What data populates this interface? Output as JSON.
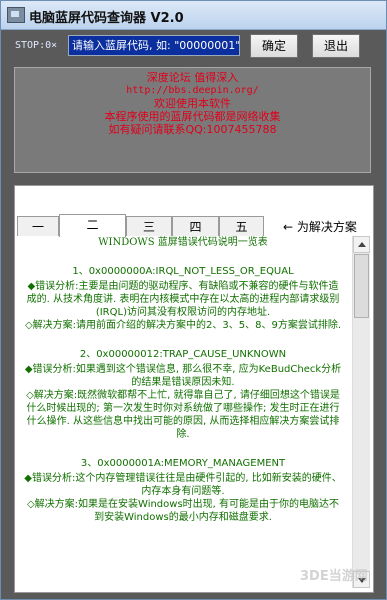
{
  "window": {
    "title": "电脑蓝屏代码查询器 V2.0"
  },
  "toolbar": {
    "status": "STOP:0×",
    "code_input_value": "请输入蓝屏代码, 如: \"00000001\".",
    "confirm_label": "确定",
    "exit_label": "退出"
  },
  "banner": {
    "lines": [
      "深度论坛 值得深入",
      "http://bbs.deepin.org/",
      "欢迎使用本软件",
      "本程序使用的蓝屏代码都是网络收集",
      "如有疑问请联系QQ:1007455788"
    ]
  },
  "tabs": [
    "一",
    "二",
    "三",
    "四",
    "五"
  ],
  "solution_link": "← 为解决方案",
  "content": {
    "heading": "WINDOWS 蓝屏错误代码说明一览表",
    "entries": [
      {
        "code": "1、0x0000000A:IRQL_NOT_LESS_OR_EQUAL",
        "analysis": "◆错误分析:主要是由问题的驱动程序、有缺陷或不兼容的硬件与软件造成的. 从技术角度讲. 表明在内核模式中存在以太高的进程内部请求级别(IRQL)访问其没有权限访问的内存地址.",
        "solution": "◇解决方案:请用前面介绍的解决方案中的2、3、5、8、9方案尝试排除."
      },
      {
        "code": "2、0x00000012:TRAP_CAUSE_UNKNOWN",
        "analysis": "◆错误分析:如果遇到这个错误信息, 那么很不幸, 应为KeBudCheck分析的结果是错误原因未知.",
        "solution": "◇解决方案:既然微软都帮不上忙, 就得靠自己了, 请仔细回想这个错误是什么时候出现的; 第一次发生时你对系统做了哪些操作; 发生时正在进行什么操作. 从这些信息中找出可能的原因, 从而选择相应解决方案尝试排除."
      },
      {
        "code": "3、0x0000001A:MEMORY_MANAGEMENT",
        "analysis": "◆错误分析:这个内存管理错误往往是由硬件引起的, 比如新安装的硬件、内存本身有问题等.",
        "solution": "◇解决方案:如果是在安装Windows时出现, 有可能是由于你的电脑达不到安装Windows的最小内存和磁盘要求."
      }
    ]
  },
  "watermark": "3DE当游网"
}
